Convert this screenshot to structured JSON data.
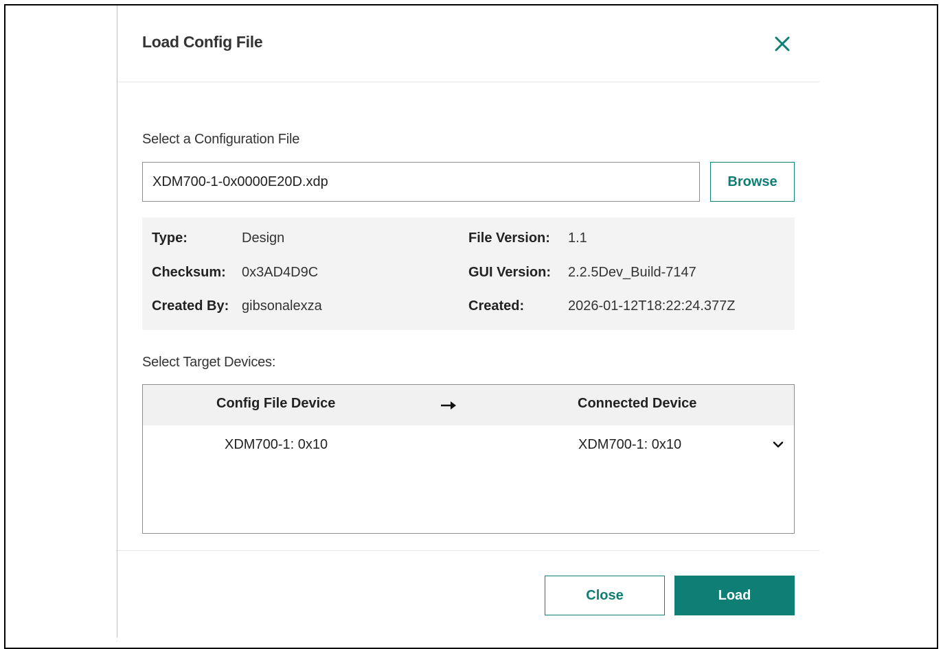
{
  "dialog": {
    "title": "Load Config File",
    "close_icon": "close-icon"
  },
  "file_select": {
    "label": "Select a Configuration File",
    "value": "XDM700-1-0x0000E20D.xdp",
    "browse_label": "Browse"
  },
  "file_info": {
    "type_label": "Type:",
    "type_value": "Design",
    "checksum_label": "Checksum:",
    "checksum_value": "0x3AD4D9C",
    "created_by_label": "Created By:",
    "created_by_value": "gibsonalexza",
    "file_version_label": "File Version:",
    "file_version_value": "1.1",
    "gui_version_label": "GUI Version:",
    "gui_version_value": "2.2.5Dev_Build-7147",
    "created_label": "Created:",
    "created_value": "2026-01-12T18:22:24.377Z"
  },
  "targets": {
    "label": "Select Target Devices:",
    "columns": {
      "config_file_device": "Config File Device",
      "arrow_icon": "right-arrow-icon",
      "connected_device": "Connected Device"
    },
    "rows": [
      {
        "config_device": "XDM700-1: 0x10",
        "connected_device": "XDM700-1: 0x10",
        "dropdown_icon": "chevron-down-icon"
      }
    ]
  },
  "footer": {
    "close_label": "Close",
    "load_label": "Load"
  },
  "colors": {
    "accent": "#0f7e74",
    "panel_bg": "#f3f3f3",
    "table_header_bg": "#f1f1f1"
  }
}
